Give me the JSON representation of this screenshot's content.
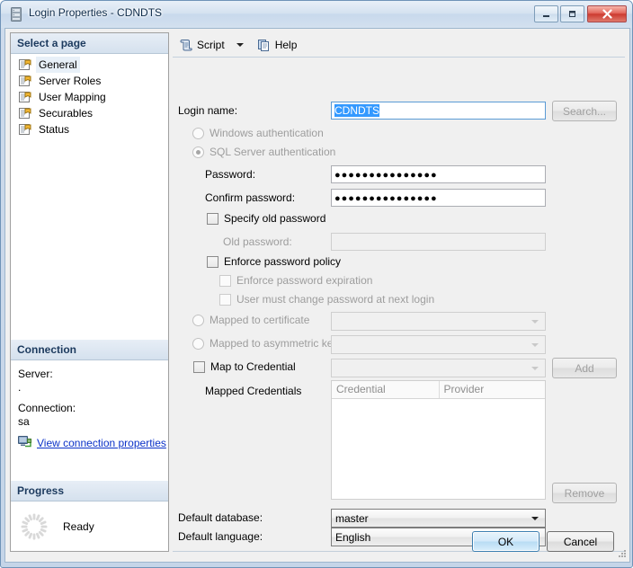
{
  "window": {
    "title": "Login Properties - CDNDTS",
    "title_icon": "server-icon",
    "minimize_label": "–",
    "maximize_label": "❐",
    "close_label": "✕"
  },
  "sidebar": {
    "select_page_header": "Select a page",
    "pages": [
      {
        "label": "General",
        "selected": true
      },
      {
        "label": "Server Roles",
        "selected": false
      },
      {
        "label": "User Mapping",
        "selected": false
      },
      {
        "label": "Securables",
        "selected": false
      },
      {
        "label": "Status",
        "selected": false
      }
    ],
    "connection_header": "Connection",
    "server_label": "Server:",
    "server_value": ".",
    "connection_label": "Connection:",
    "connection_value": "sa",
    "view_connection_link": "View connection properties",
    "progress_header": "Progress",
    "progress_status": "Ready"
  },
  "toolbar": {
    "script_label": "Script",
    "help_label": "Help"
  },
  "form": {
    "login_name_label": "Login name:",
    "login_name_value": "CDNDTS",
    "search_button": "Search...",
    "windows_auth_label": "Windows authentication",
    "sql_auth_label": "SQL Server authentication",
    "password_label": "Password:",
    "password_value": "●●●●●●●●●●●●●●●",
    "confirm_password_label": "Confirm password:",
    "confirm_password_value": "●●●●●●●●●●●●●●●",
    "specify_old_password_label": "Specify old password",
    "old_password_label": "Old password:",
    "old_password_value": "",
    "enforce_policy_label": "Enforce password policy",
    "enforce_expiration_label": "Enforce password expiration",
    "must_change_label": "User must change password at next login",
    "mapped_certificate_label": "Mapped to certificate",
    "mapped_certificate_value": "",
    "mapped_asymmetric_label": "Mapped to asymmetric key",
    "mapped_asymmetric_value": "",
    "map_credential_label": "Map to Credential",
    "map_credential_value": "",
    "add_button": "Add",
    "mapped_credentials_label": "Mapped Credentials",
    "credentials_columns": [
      "Credential",
      "Provider"
    ],
    "credentials_rows": [],
    "remove_button": "Remove",
    "default_database_label": "Default database:",
    "default_database_value": "master",
    "default_language_label": "Default language:",
    "default_language_value": "English"
  },
  "footer": {
    "ok_button": "OK",
    "cancel_button": "Cancel"
  },
  "colors": {
    "selection_blue": "#3399ff",
    "link_blue": "#0a31c8",
    "section_header_text": "#1c3a5e",
    "disabled_text": "#9d9d9d",
    "close_red": "#cc3b30"
  }
}
